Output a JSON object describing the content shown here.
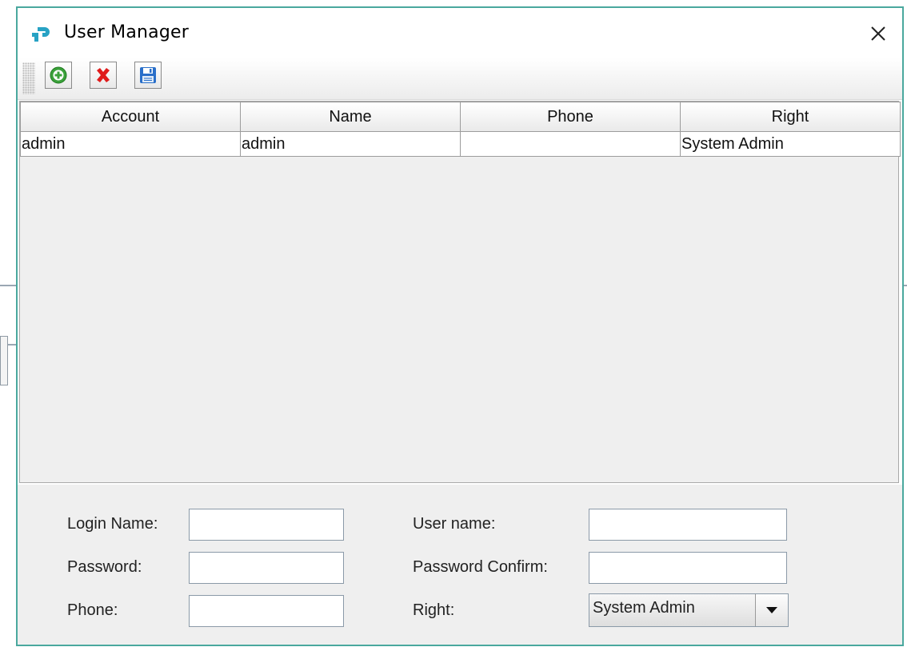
{
  "window": {
    "title": "User Manager",
    "close_glyph": "✕"
  },
  "toolbar": {
    "buttons": [
      {
        "name": "add",
        "icon": "add-circle-icon",
        "color": "#3aa13a"
      },
      {
        "name": "delete",
        "icon": "delete-x-icon",
        "color": "#e01b1b"
      },
      {
        "name": "save",
        "icon": "floppy-disk-icon",
        "color": "#2a6fc9"
      }
    ]
  },
  "table": {
    "columns": [
      "Account",
      "Name",
      "Phone",
      "Right"
    ],
    "rows": [
      [
        "admin",
        "admin",
        "",
        "System Admin"
      ]
    ]
  },
  "form": {
    "login_name_label": "Login Name:",
    "login_name_value": "",
    "password_label": "Password:",
    "password_value": "",
    "phone_label": "Phone:",
    "phone_value": "",
    "user_name_label": "User name:",
    "user_name_value": "",
    "password_confirm_label": "Password Confirm:",
    "password_confirm_value": "",
    "right_label": "Right:",
    "right_selected": "System Admin"
  },
  "colors": {
    "window_border": "#4aa89e",
    "logo": "#27a2c4"
  }
}
